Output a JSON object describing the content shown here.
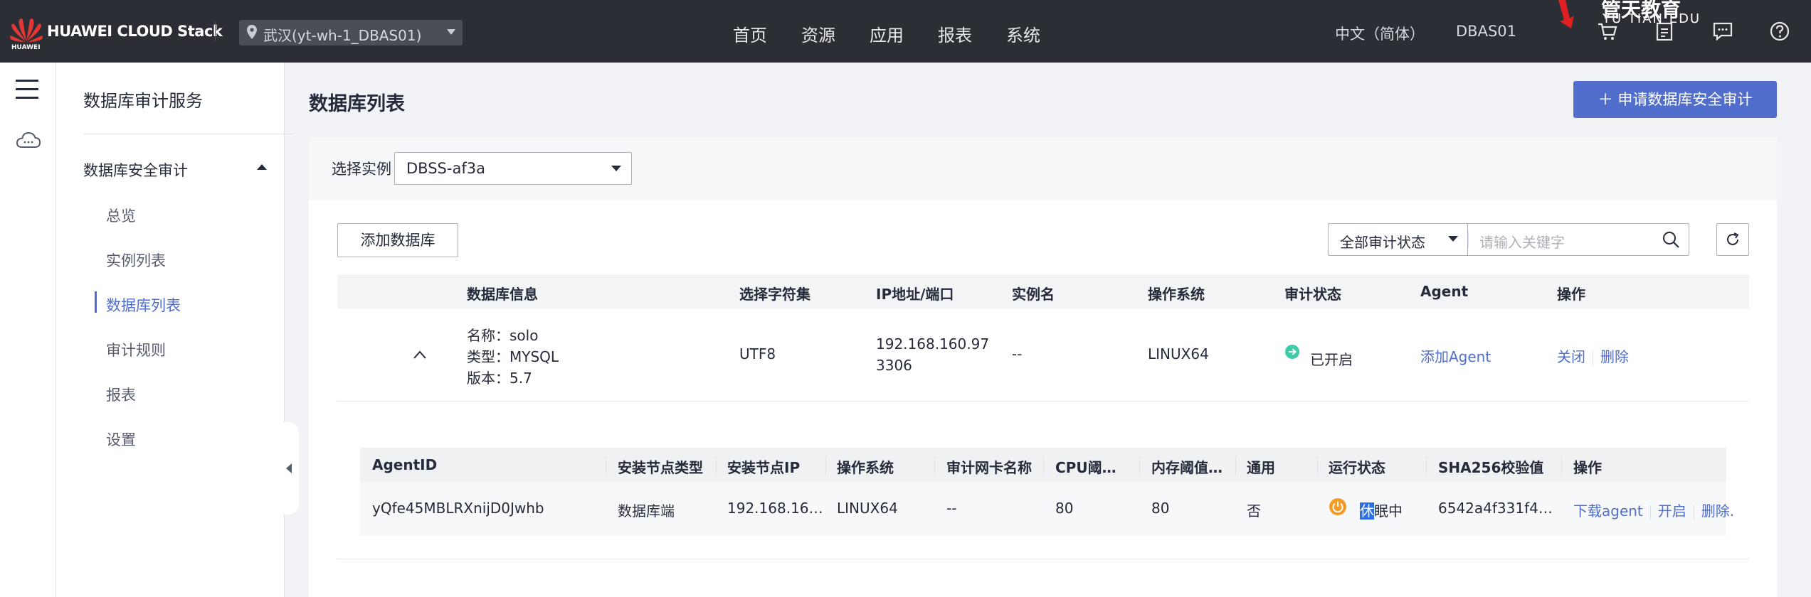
{
  "topbar": {
    "brand": "HUAWEI CLOUD Stack",
    "brand_small": "HUAWEI",
    "region": "武汉(yt-wh-1_DBAS01)",
    "nav": [
      "首页",
      "资源",
      "应用",
      "报表",
      "系统"
    ],
    "language": "中文（简体）",
    "user": "DBAS01",
    "overlay_title": "管天教育",
    "overlay_sub": "YU TIAN EDU",
    "icons": [
      "cart-icon",
      "clipboard-icon",
      "message-icon",
      "help-icon"
    ]
  },
  "sidebar": {
    "title": "数据库审计服务",
    "group": "数据库安全审计",
    "items": [
      "总览",
      "实例列表",
      "数据库列表",
      "审计规则",
      "报表",
      "设置"
    ],
    "active": "数据库列表"
  },
  "main": {
    "title": "数据库列表",
    "primary_button": "＋ 申请数据库安全审计",
    "instance_label": "选择实例",
    "instance_value": "DBSS-af3a",
    "add_button": "添加数据库",
    "status_filter": "全部审计状态",
    "search_placeholder": "请输入关键字"
  },
  "table": {
    "headers": [
      "数据库信息",
      "选择字符集",
      "IP地址/端口",
      "实例名",
      "操作系统",
      "审计状态",
      "Agent",
      "操作"
    ],
    "row": {
      "name": "名称：solo",
      "type": "类型：MYSQL",
      "version": "版本：5.7",
      "charset": "UTF8",
      "ip": "192.168.160.97",
      "port": "3306",
      "instance": "--",
      "os": "LINUX64",
      "audit_status": "已开启",
      "agent": "添加Agent",
      "action_close": "关闭",
      "action_delete": "删除"
    }
  },
  "agent_table": {
    "headers": [
      "AgentID",
      "安装节点类型",
      "安装节点IP",
      "操作系统",
      "审计网卡名称",
      "CPU阈…",
      "内存阈值…",
      "通用",
      "运行状态",
      "SHA256校验值",
      "操作"
    ],
    "row": {
      "agent_id": "yQfe45MBLRXnijD0Jwhb",
      "node_type": "数据库端",
      "node_ip": "192.168.16…",
      "os": "LINUX64",
      "nic": "--",
      "cpu": "80",
      "mem": "80",
      "general": "否",
      "run_status_hl": "休",
      "run_status_rest": "眠中",
      "sha256": "6542a4f331f4…",
      "action_download": "下载agent",
      "action_start": "开启",
      "action_delete": "删除."
    }
  },
  "colors": {
    "topbar": "#2b2e35",
    "accent": "#526ecc",
    "status_on": "#3dcca6",
    "status_sleep": "#f59a23",
    "logo_red": "#e23834"
  }
}
